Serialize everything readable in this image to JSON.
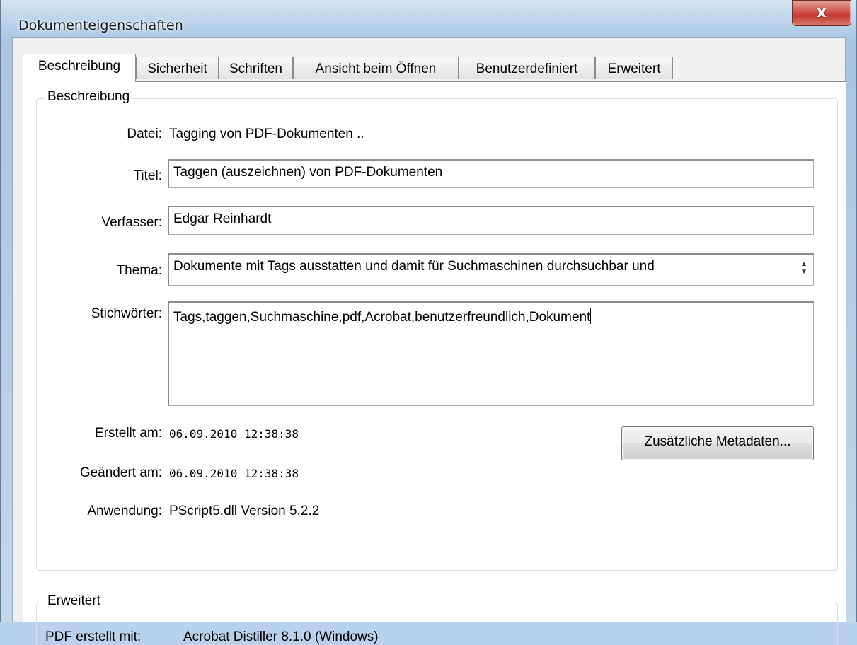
{
  "window": {
    "title": "Dokumenteigenschaften",
    "close_glyph": "x"
  },
  "tabs": [
    {
      "label": "Beschreibung",
      "active": true
    },
    {
      "label": "Sicherheit",
      "active": false
    },
    {
      "label": "Schriften",
      "active": false
    },
    {
      "label": "Ansicht beim Öffnen",
      "active": false
    },
    {
      "label": "Benutzerdefiniert",
      "active": false
    },
    {
      "label": "Erweitert",
      "active": false
    }
  ],
  "description_group": {
    "legend": "Beschreibung",
    "file": {
      "label": "Datei:",
      "value": "Tagging von PDF-Dokumenten .."
    },
    "title": {
      "label": "Titel:",
      "value": "Taggen (auszeichnen) von PDF-Dokumenten"
    },
    "author": {
      "label": "Verfasser:",
      "value": "Edgar Reinhardt"
    },
    "subject": {
      "label": "Thema:",
      "value": "Dokumente mit Tags ausstatten und damit für Suchmaschinen durchsuchbar und"
    },
    "keywords": {
      "label": "Stichwörter:",
      "value": "Tags,taggen,Suchmaschine,pdf,Acrobat,benutzerfreundlich,Dokument"
    },
    "created": {
      "label": "Erstellt am:",
      "value": "06.09.2010 12:38:38"
    },
    "modified": {
      "label": "Geändert am:",
      "value": "06.09.2010 12:38:38"
    },
    "application": {
      "label": "Anwendung:",
      "value": "PScript5.dll Version 5.2.2"
    },
    "metadata_button": "Zusätzliche Metadaten..."
  },
  "advanced_group": {
    "legend": "Erweitert",
    "pdf_producer": {
      "label": "PDF erstellt mit:",
      "value": "Acrobat Distiller 8.1.0 (Windows)"
    }
  }
}
